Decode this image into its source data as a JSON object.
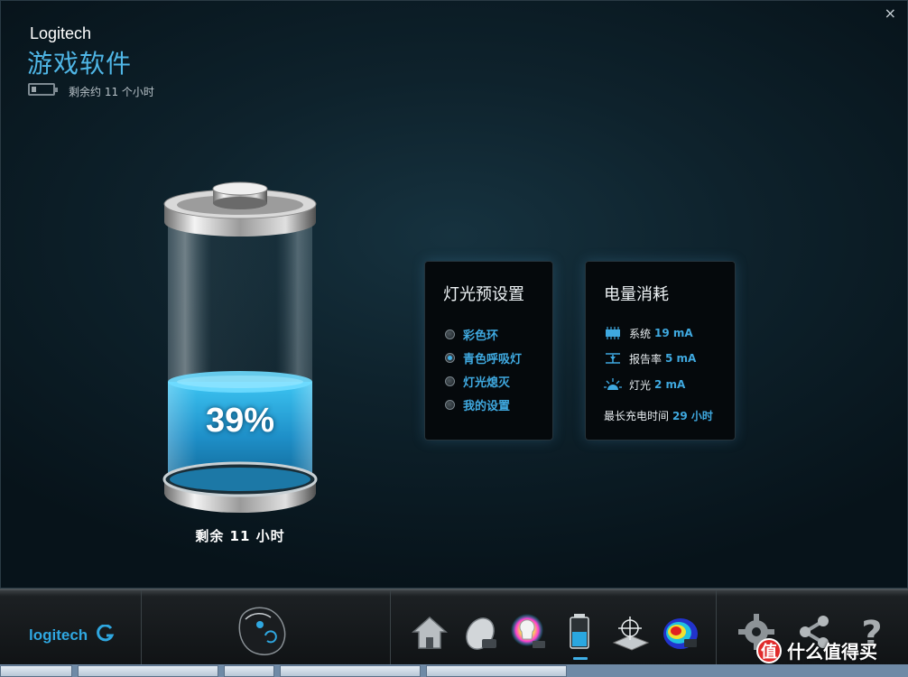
{
  "header": {
    "brand": "Logitech",
    "title": "游戏软件",
    "battery_summary": "剩余约 11 个小时",
    "close_glyph": "×"
  },
  "battery": {
    "percent_text": "39%",
    "percent_value": 39,
    "remaining": "剩余 11 小时",
    "fill_color": "#2aa7e0"
  },
  "lighting_presets": {
    "title": "灯光预设置",
    "options": [
      {
        "label": "彩色环",
        "selected": false
      },
      {
        "label": "青色呼吸灯",
        "selected": true
      },
      {
        "label": "灯光熄灭",
        "selected": false
      },
      {
        "label": "我的设置",
        "selected": false
      }
    ]
  },
  "power_consumption": {
    "title": "电量消耗",
    "items": [
      {
        "icon": "chip-icon",
        "label": "系统",
        "value": "19 mA"
      },
      {
        "icon": "report-rate-icon",
        "label": "报告率",
        "value": "5 mA"
      },
      {
        "icon": "light-icon",
        "label": "灯光",
        "value": "2 mA"
      }
    ],
    "max_charge_label": "最长充电时间",
    "max_charge_value": "29 小时"
  },
  "bottom_bar": {
    "logo": "logitech",
    "device": "mouse-icon",
    "nav_icons": [
      "home-icon",
      "mouse-buttons-icon",
      "lighting-icon",
      "battery-icon",
      "pointer-settings-icon",
      "heatmap-icon"
    ],
    "right_icons": [
      "settings-gear-icon",
      "share-icon",
      "help-icon"
    ],
    "accent": "#3fb0e8"
  },
  "watermark": {
    "glyph": "值",
    "text": "什么值得买"
  }
}
